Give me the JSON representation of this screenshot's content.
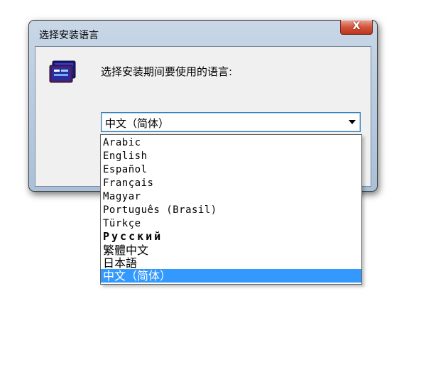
{
  "window": {
    "title": "选择安装语言",
    "close_symbol": "X",
    "icon": "monitor-icon"
  },
  "dialog": {
    "prompt": "选择安装期间要使用的语言:"
  },
  "combo": {
    "selected": "中文（简体）"
  },
  "languages": [
    "Arabic",
    "English",
    "Español",
    "Français",
    "Magyar",
    "Português (Brasil)",
    "Türkçe",
    "Русский",
    "繁體中文",
    "日本語",
    "中文（简体）"
  ],
  "colors": {
    "selection": "#3399ff",
    "close_button": "#c0331c"
  }
}
